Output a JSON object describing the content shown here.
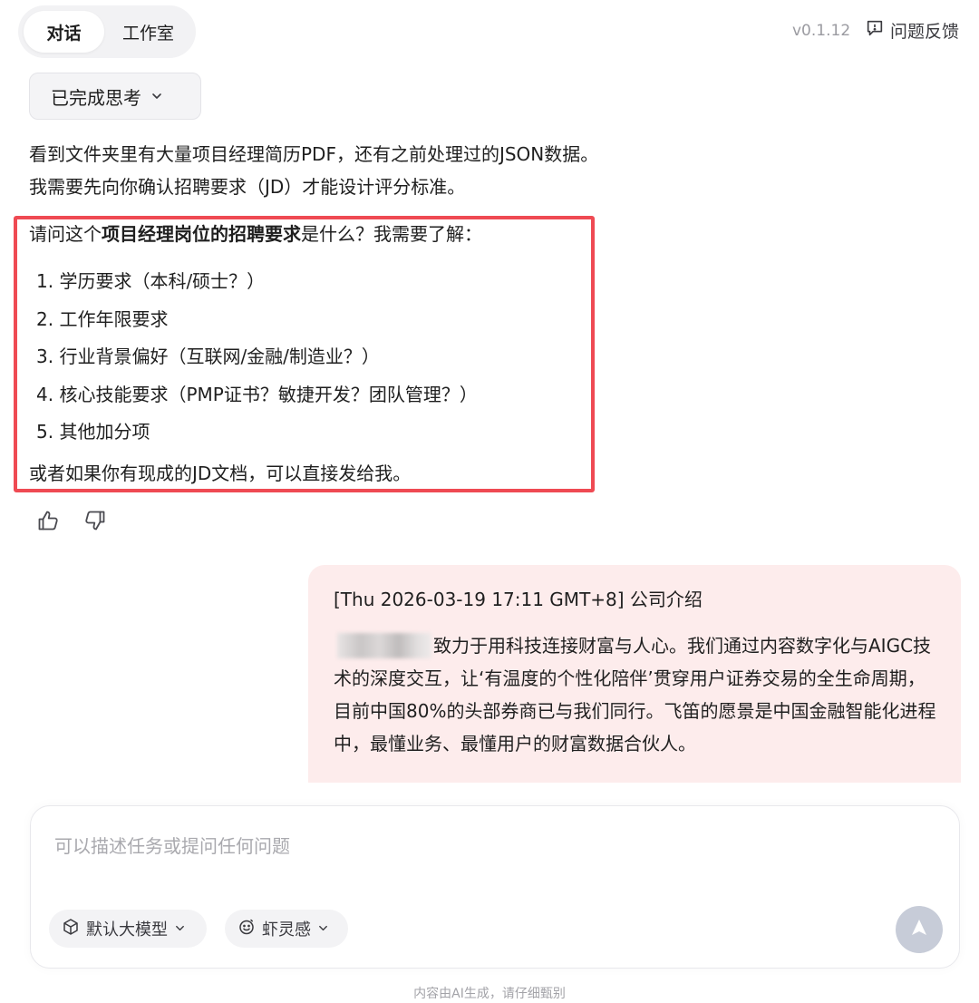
{
  "header": {
    "tabs": [
      {
        "label": "对话",
        "active": true
      },
      {
        "label": "工作室",
        "active": false
      }
    ],
    "version": "v0.1.12",
    "feedback_label": "问题反馈"
  },
  "assistant": {
    "thinking_label": "已完成思考",
    "paragraph_line1": "看到文件夹里有大量项目经理简历PDF，还有之前处理过的JSON数据。",
    "paragraph_line2": "我需要先向你确认招聘要求（JD）才能设计评分标准。",
    "question_prefix": "请问这个",
    "question_bold": "项目经理岗位的招聘要求",
    "question_suffix": "是什么？我需要了解：",
    "requirements": [
      "1. 学历要求（本科/硕士？）",
      "2. 工作年限要求",
      "3. 行业背景偏好（互联网/金融/制造业？）",
      "4. 核心技能要求（PMP证书？敏捷开发？团队管理？）",
      "5. 其他加分项"
    ],
    "closing": "或者如果你有现成的JD文档，可以直接发给我。"
  },
  "user_message": {
    "meta": "[Thu 2026-03-19 17:11 GMT+8] 公司介绍",
    "body": "致力于用科技连接财富与人心。我们通过内容数字化与AIGC技术的深度交互，让‘有温度的个性化陪伴’贯穿用户证券交易的全生命周期，目前中国80%的头部券商已与我们同行。飞笛的愿景是中国金融智能化进程中，最懂业务、最懂用户的财富数据合伙人。"
  },
  "composer": {
    "placeholder": "可以描述任务或提问任何问题",
    "model_label": "默认大模型",
    "persona_label": "虾灵感"
  },
  "footer": {
    "disclaimer": "内容由AI生成，请仔细甄别"
  },
  "colors": {
    "highlight_border": "#ef4a53",
    "user_bubble": "#fdecec",
    "send_button": "#c7ccd8"
  }
}
